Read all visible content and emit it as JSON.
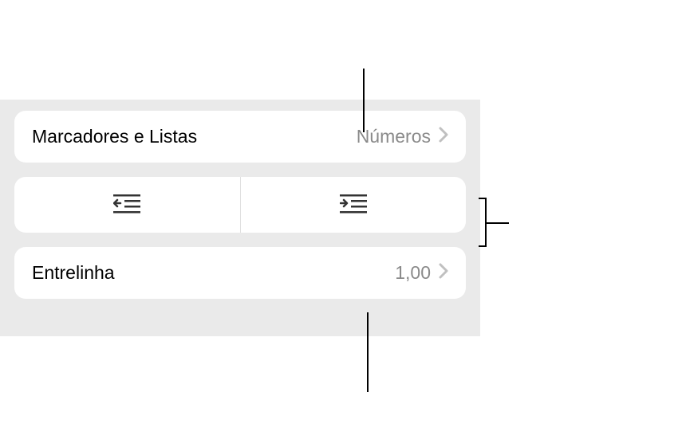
{
  "rows": {
    "bullets": {
      "label": "Marcadores e Listas",
      "value": "Números"
    },
    "lineSpacing": {
      "label": "Entrelinha",
      "value": "1,00"
    }
  }
}
